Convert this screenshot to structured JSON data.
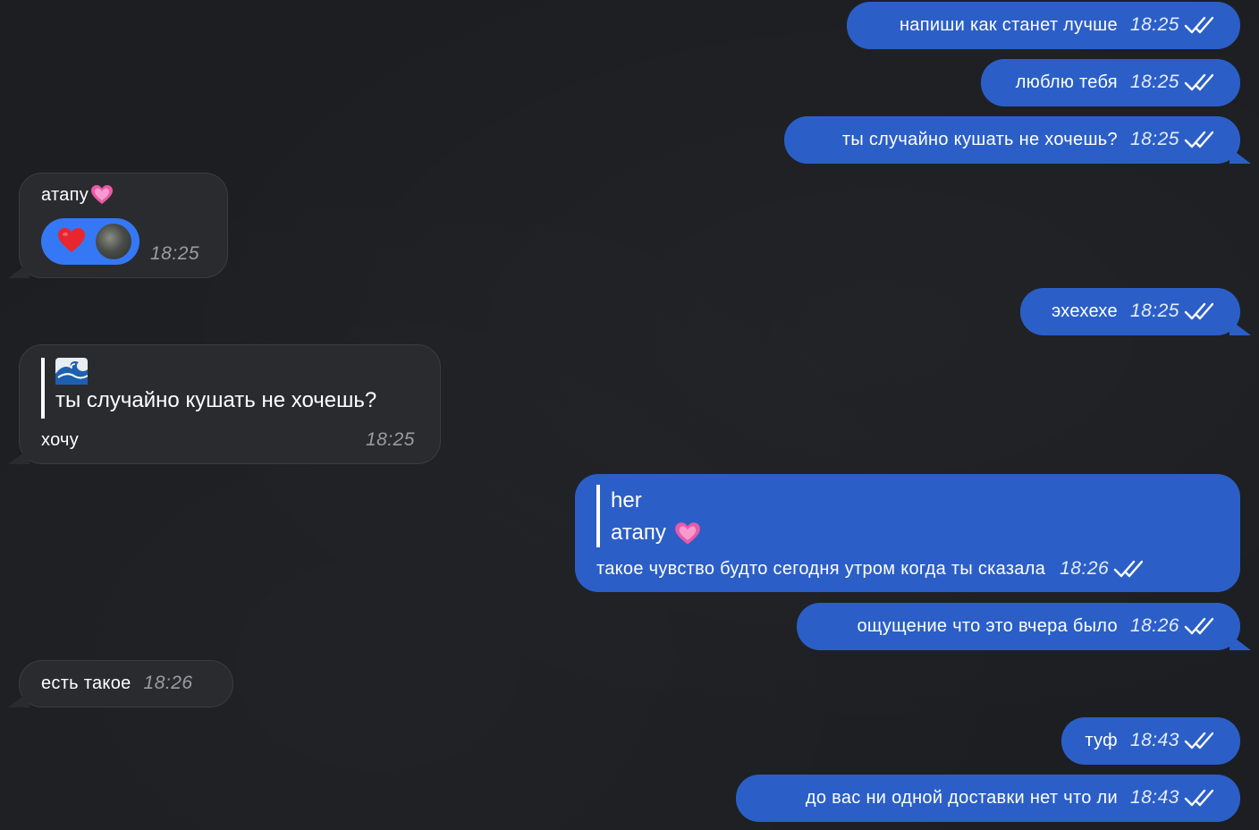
{
  "colors": {
    "outgoing_bubble": "#2b5fc7",
    "incoming_bubble": "#2a2b2f",
    "background": "#1c1e22",
    "reaction_pill": "#3478f6"
  },
  "messages": [
    {
      "direction": "outgoing",
      "text": "напиши как станет лучше",
      "time": "18:25",
      "status": "read"
    },
    {
      "direction": "outgoing",
      "text": "люблю тебя",
      "time": "18:25",
      "status": "read"
    },
    {
      "direction": "outgoing",
      "text": "ты случайно кушать не хочешь?",
      "time": "18:25",
      "status": "read"
    },
    {
      "direction": "incoming",
      "text": "атапу",
      "emoji": "pink-heart",
      "time": "18:25",
      "reaction": {
        "emoji": "red-heart-icon",
        "by": "avatar"
      }
    },
    {
      "direction": "outgoing",
      "text": "эхехехе",
      "time": "18:25",
      "status": "read"
    },
    {
      "direction": "incoming",
      "text": "хочу",
      "time": "18:25",
      "reply": {
        "sender_emoji": "wave-icon",
        "text": "ты случайно кушать не хочешь?"
      }
    },
    {
      "direction": "outgoing",
      "text": "такое чувство будто сегодня утром когда ты сказала",
      "time": "18:26",
      "status": "read",
      "reply": {
        "sender": "her",
        "text": "атапу"
      }
    },
    {
      "direction": "outgoing",
      "text": "ощущение что это вчера было",
      "time": "18:26",
      "status": "read"
    },
    {
      "direction": "incoming",
      "text": "есть такое",
      "time": "18:26"
    },
    {
      "direction": "outgoing",
      "text": "туф",
      "time": "18:43",
      "status": "read"
    },
    {
      "direction": "outgoing",
      "text": "до вас ни одной доставки нет что ли",
      "time": "18:43",
      "status": "read"
    }
  ]
}
